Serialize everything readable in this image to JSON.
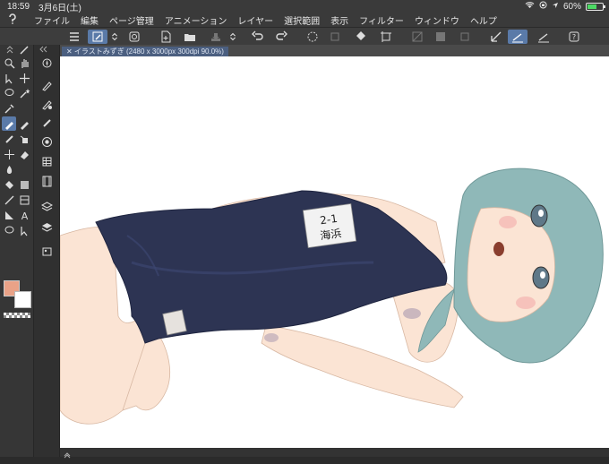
{
  "status": {
    "time": "18:59",
    "date": "3月6日(土)",
    "battery_percent": "60%",
    "battery_level": 0.6
  },
  "menu": {
    "items": [
      "ファイル",
      "編集",
      "ページ管理",
      "アニメーション",
      "レイヤー",
      "選択範囲",
      "表示",
      "フィルター",
      "ウィンドウ",
      "ヘルプ"
    ]
  },
  "document": {
    "tab_label": "✕ イラストみずぎ (2480 x 3000px 300dpi 90.0%)"
  },
  "colors": {
    "main": "#e9a287",
    "sub": "#ffffff",
    "accent": "#5a7aa8"
  },
  "canvas": {
    "name_tag_line1": "2-1",
    "name_tag_line2": "海浜"
  }
}
